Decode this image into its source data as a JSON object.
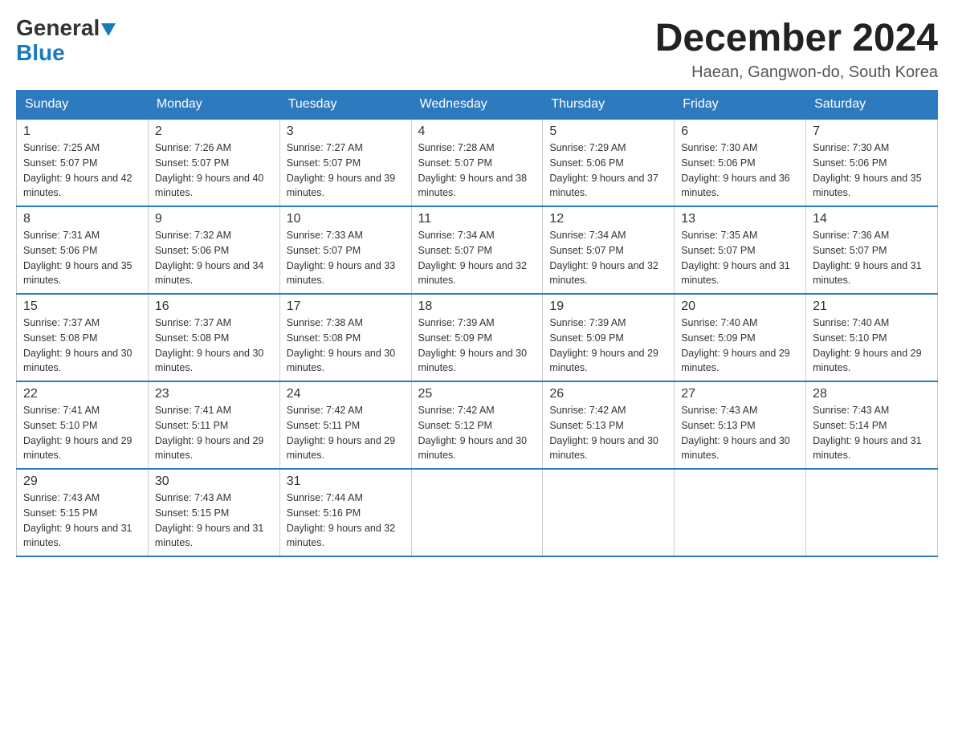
{
  "header": {
    "logo_general": "General",
    "logo_blue": "Blue",
    "month": "December 2024",
    "location": "Haean, Gangwon-do, South Korea"
  },
  "days_of_week": [
    "Sunday",
    "Monday",
    "Tuesday",
    "Wednesday",
    "Thursday",
    "Friday",
    "Saturday"
  ],
  "weeks": [
    [
      {
        "day": "1",
        "sunrise": "Sunrise: 7:25 AM",
        "sunset": "Sunset: 5:07 PM",
        "daylight": "Daylight: 9 hours and 42 minutes."
      },
      {
        "day": "2",
        "sunrise": "Sunrise: 7:26 AM",
        "sunset": "Sunset: 5:07 PM",
        "daylight": "Daylight: 9 hours and 40 minutes."
      },
      {
        "day": "3",
        "sunrise": "Sunrise: 7:27 AM",
        "sunset": "Sunset: 5:07 PM",
        "daylight": "Daylight: 9 hours and 39 minutes."
      },
      {
        "day": "4",
        "sunrise": "Sunrise: 7:28 AM",
        "sunset": "Sunset: 5:07 PM",
        "daylight": "Daylight: 9 hours and 38 minutes."
      },
      {
        "day": "5",
        "sunrise": "Sunrise: 7:29 AM",
        "sunset": "Sunset: 5:06 PM",
        "daylight": "Daylight: 9 hours and 37 minutes."
      },
      {
        "day": "6",
        "sunrise": "Sunrise: 7:30 AM",
        "sunset": "Sunset: 5:06 PM",
        "daylight": "Daylight: 9 hours and 36 minutes."
      },
      {
        "day": "7",
        "sunrise": "Sunrise: 7:30 AM",
        "sunset": "Sunset: 5:06 PM",
        "daylight": "Daylight: 9 hours and 35 minutes."
      }
    ],
    [
      {
        "day": "8",
        "sunrise": "Sunrise: 7:31 AM",
        "sunset": "Sunset: 5:06 PM",
        "daylight": "Daylight: 9 hours and 35 minutes."
      },
      {
        "day": "9",
        "sunrise": "Sunrise: 7:32 AM",
        "sunset": "Sunset: 5:06 PM",
        "daylight": "Daylight: 9 hours and 34 minutes."
      },
      {
        "day": "10",
        "sunrise": "Sunrise: 7:33 AM",
        "sunset": "Sunset: 5:07 PM",
        "daylight": "Daylight: 9 hours and 33 minutes."
      },
      {
        "day": "11",
        "sunrise": "Sunrise: 7:34 AM",
        "sunset": "Sunset: 5:07 PM",
        "daylight": "Daylight: 9 hours and 32 minutes."
      },
      {
        "day": "12",
        "sunrise": "Sunrise: 7:34 AM",
        "sunset": "Sunset: 5:07 PM",
        "daylight": "Daylight: 9 hours and 32 minutes."
      },
      {
        "day": "13",
        "sunrise": "Sunrise: 7:35 AM",
        "sunset": "Sunset: 5:07 PM",
        "daylight": "Daylight: 9 hours and 31 minutes."
      },
      {
        "day": "14",
        "sunrise": "Sunrise: 7:36 AM",
        "sunset": "Sunset: 5:07 PM",
        "daylight": "Daylight: 9 hours and 31 minutes."
      }
    ],
    [
      {
        "day": "15",
        "sunrise": "Sunrise: 7:37 AM",
        "sunset": "Sunset: 5:08 PM",
        "daylight": "Daylight: 9 hours and 30 minutes."
      },
      {
        "day": "16",
        "sunrise": "Sunrise: 7:37 AM",
        "sunset": "Sunset: 5:08 PM",
        "daylight": "Daylight: 9 hours and 30 minutes."
      },
      {
        "day": "17",
        "sunrise": "Sunrise: 7:38 AM",
        "sunset": "Sunset: 5:08 PM",
        "daylight": "Daylight: 9 hours and 30 minutes."
      },
      {
        "day": "18",
        "sunrise": "Sunrise: 7:39 AM",
        "sunset": "Sunset: 5:09 PM",
        "daylight": "Daylight: 9 hours and 30 minutes."
      },
      {
        "day": "19",
        "sunrise": "Sunrise: 7:39 AM",
        "sunset": "Sunset: 5:09 PM",
        "daylight": "Daylight: 9 hours and 29 minutes."
      },
      {
        "day": "20",
        "sunrise": "Sunrise: 7:40 AM",
        "sunset": "Sunset: 5:09 PM",
        "daylight": "Daylight: 9 hours and 29 minutes."
      },
      {
        "day": "21",
        "sunrise": "Sunrise: 7:40 AM",
        "sunset": "Sunset: 5:10 PM",
        "daylight": "Daylight: 9 hours and 29 minutes."
      }
    ],
    [
      {
        "day": "22",
        "sunrise": "Sunrise: 7:41 AM",
        "sunset": "Sunset: 5:10 PM",
        "daylight": "Daylight: 9 hours and 29 minutes."
      },
      {
        "day": "23",
        "sunrise": "Sunrise: 7:41 AM",
        "sunset": "Sunset: 5:11 PM",
        "daylight": "Daylight: 9 hours and 29 minutes."
      },
      {
        "day": "24",
        "sunrise": "Sunrise: 7:42 AM",
        "sunset": "Sunset: 5:11 PM",
        "daylight": "Daylight: 9 hours and 29 minutes."
      },
      {
        "day": "25",
        "sunrise": "Sunrise: 7:42 AM",
        "sunset": "Sunset: 5:12 PM",
        "daylight": "Daylight: 9 hours and 30 minutes."
      },
      {
        "day": "26",
        "sunrise": "Sunrise: 7:42 AM",
        "sunset": "Sunset: 5:13 PM",
        "daylight": "Daylight: 9 hours and 30 minutes."
      },
      {
        "day": "27",
        "sunrise": "Sunrise: 7:43 AM",
        "sunset": "Sunset: 5:13 PM",
        "daylight": "Daylight: 9 hours and 30 minutes."
      },
      {
        "day": "28",
        "sunrise": "Sunrise: 7:43 AM",
        "sunset": "Sunset: 5:14 PM",
        "daylight": "Daylight: 9 hours and 31 minutes."
      }
    ],
    [
      {
        "day": "29",
        "sunrise": "Sunrise: 7:43 AM",
        "sunset": "Sunset: 5:15 PM",
        "daylight": "Daylight: 9 hours and 31 minutes."
      },
      {
        "day": "30",
        "sunrise": "Sunrise: 7:43 AM",
        "sunset": "Sunset: 5:15 PM",
        "daylight": "Daylight: 9 hours and 31 minutes."
      },
      {
        "day": "31",
        "sunrise": "Sunrise: 7:44 AM",
        "sunset": "Sunset: 5:16 PM",
        "daylight": "Daylight: 9 hours and 32 minutes."
      },
      null,
      null,
      null,
      null
    ]
  ]
}
